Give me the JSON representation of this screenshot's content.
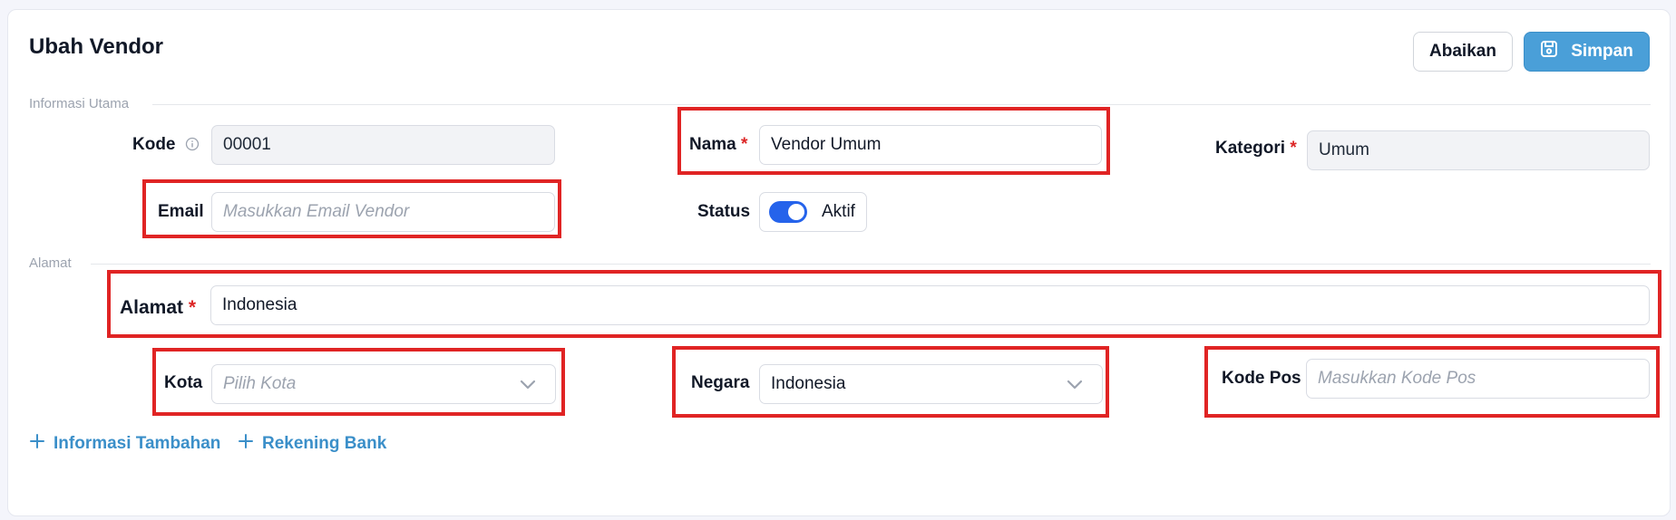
{
  "page": {
    "title": "Ubah Vendor"
  },
  "actions": {
    "cancel_label": "Abaikan",
    "save_label": "Simpan",
    "save_icon": "save-icon"
  },
  "sections": {
    "main": "Informasi Utama",
    "address": "Alamat"
  },
  "fields": {
    "kode": {
      "label": "Kode",
      "value": "00001",
      "info_icon": "info-icon"
    },
    "nama": {
      "label": "Nama",
      "required": "*",
      "value": "Vendor Umum"
    },
    "kategori": {
      "label": "Kategori",
      "required": "*",
      "value": "Umum"
    },
    "email": {
      "label": "Email",
      "placeholder": "Masukkan Email Vendor"
    },
    "status": {
      "label": "Status",
      "value": "Aktif",
      "on": true
    },
    "alamat": {
      "label": "Alamat",
      "required": "*",
      "value": "Indonesia"
    },
    "kota": {
      "label": "Kota",
      "placeholder": "Pilih Kota"
    },
    "negara": {
      "label": "Negara",
      "value": "Indonesia"
    },
    "kode_pos": {
      "label": "Kode Pos",
      "placeholder": "Masukkan Kode Pos"
    }
  },
  "links": {
    "info_tambahan": "Informasi Tambahan",
    "rekening_bank": "Rekening Bank"
  },
  "colors": {
    "accent": "#4a9fd8",
    "link": "#3b8fc9",
    "toggle": "#2563eb",
    "highlight": "#e02424",
    "required": "#dc2626"
  }
}
